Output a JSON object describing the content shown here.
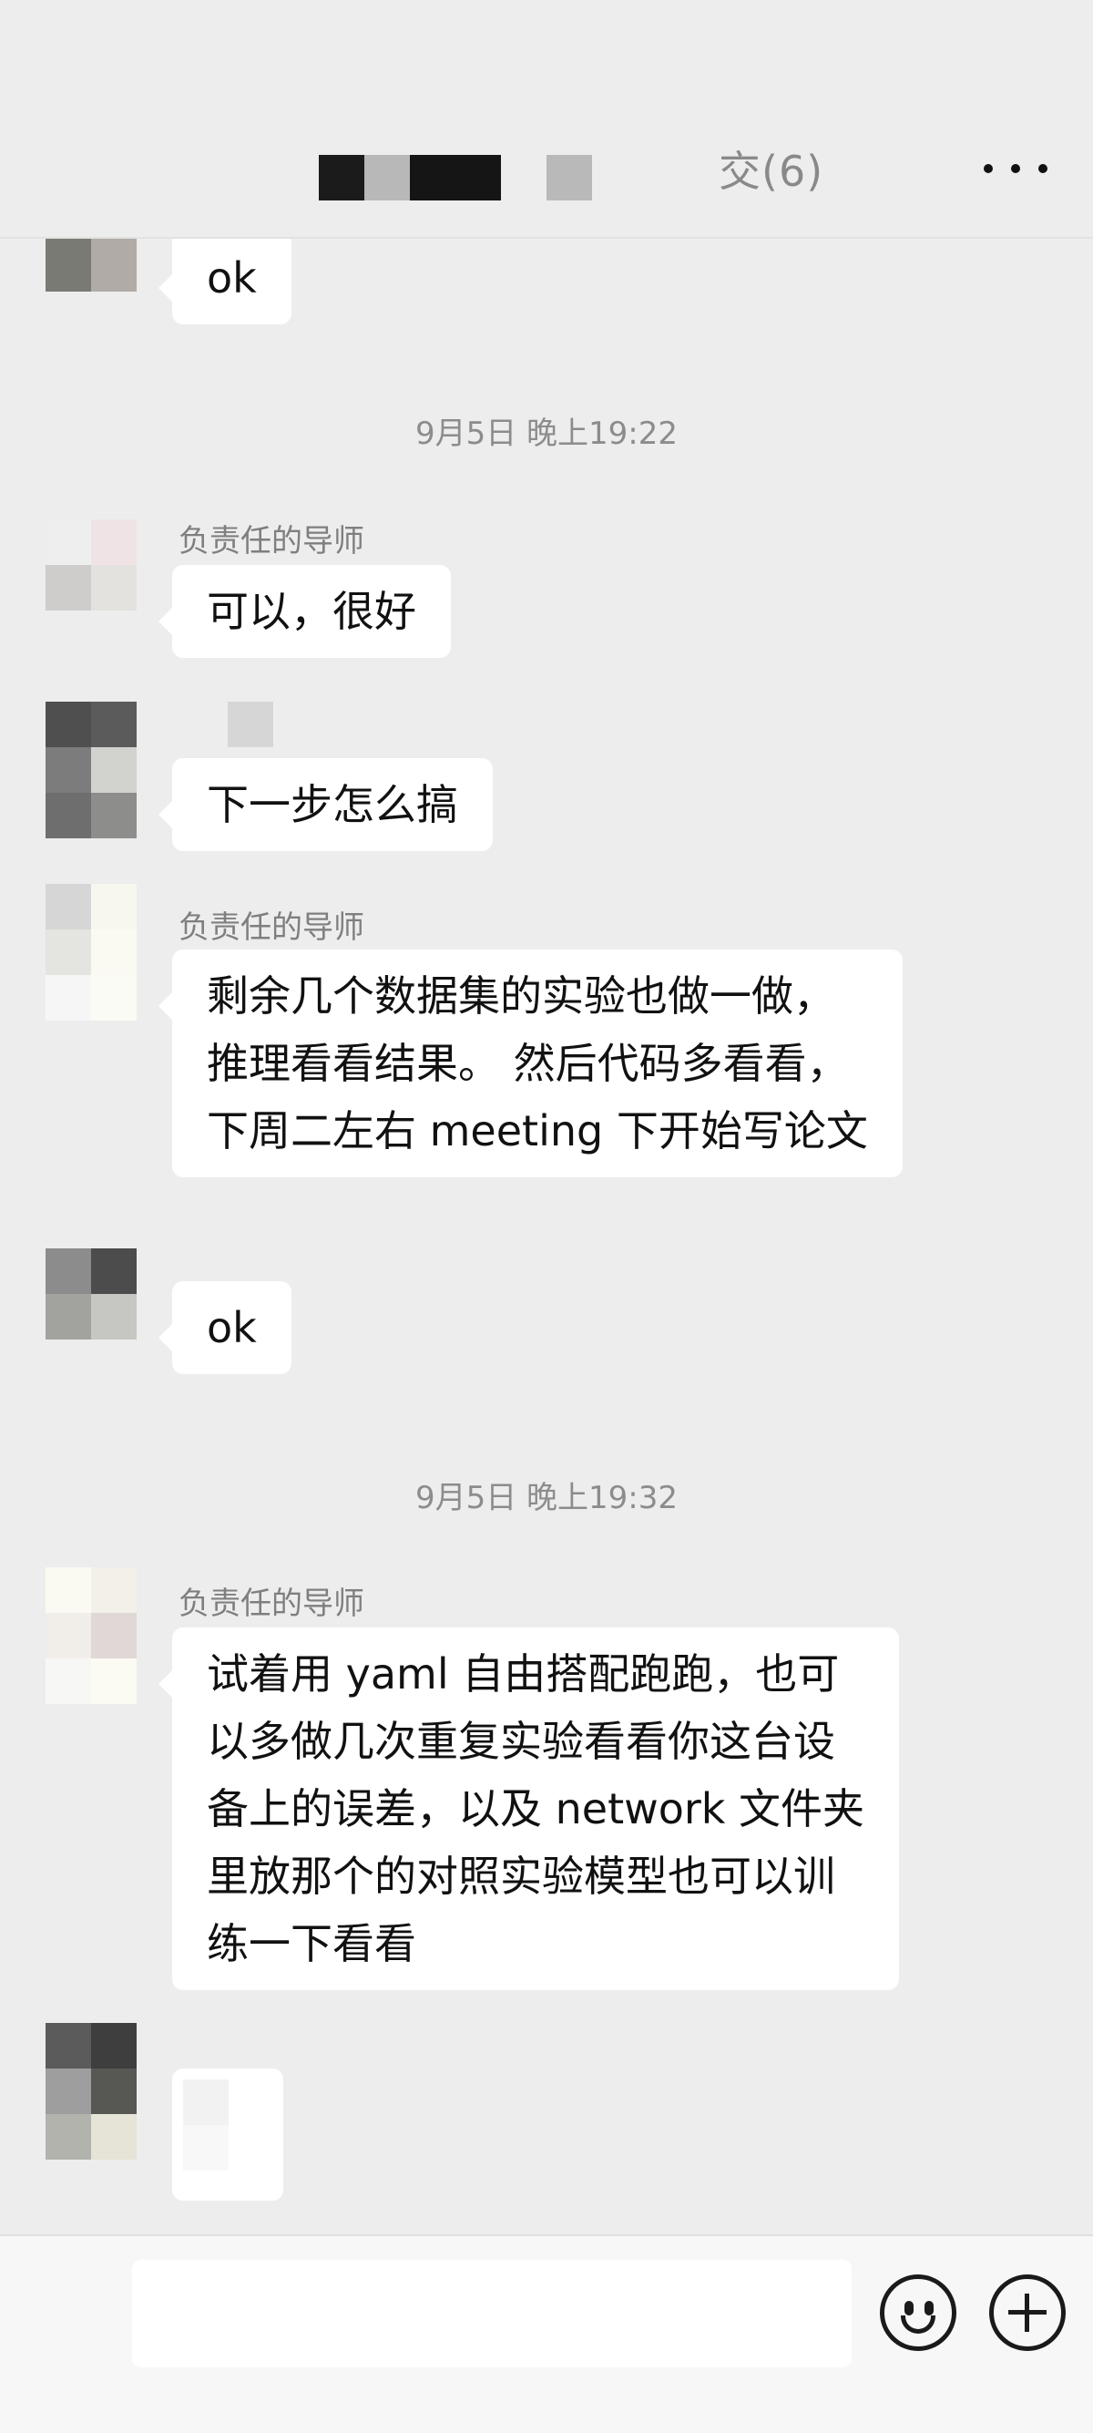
{
  "header": {
    "title_partial": "交(6)",
    "more_icon": "more-icon"
  },
  "messages": [
    {
      "text": "ok"
    },
    {
      "time": "9月5日 晚上19:22"
    },
    {
      "sender": "负责任的导师",
      "text": "可以，很好"
    },
    {
      "text": "下一步怎么搞"
    },
    {
      "sender": "负责任的导师",
      "text": "剩余几个数据集的实验也做一做，\n推理看看结果。 然后代码多看看，\n下周二左右 meeting 下开始写论文"
    },
    {
      "text": "ok"
    },
    {
      "time": "9月5日 晚上19:32"
    },
    {
      "sender": "负责任的导师",
      "text": "试着用 yaml 自由搭配跑跑，也可\n以多做几次重复实验看看你这台设\n备上的误差，以及 network 文件夹\n里放那个的对照实验模型也可以训\n练一下看看"
    }
  ],
  "input": {
    "placeholder": "",
    "emoji_icon": "emoji-icon",
    "plus_icon": "plus-icon"
  },
  "colors": {
    "background": "#ededed",
    "bubble": "#ffffff",
    "timestamp": "#8c8c8c",
    "sender_name": "#7f7f7f"
  }
}
